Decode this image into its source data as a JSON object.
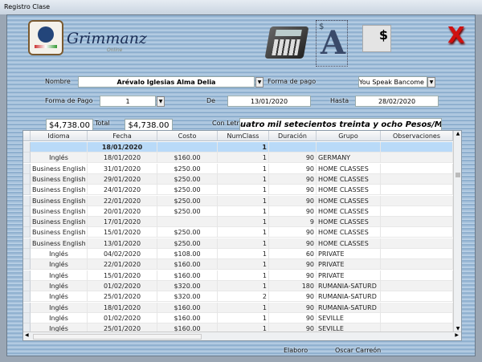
{
  "window": {
    "title": "Registro Clase"
  },
  "logo": {
    "text": "Grimmanz",
    "subtext": "Online"
  },
  "toolbar": {
    "calculator": "calculator-icon",
    "letter": "A",
    "letter_prefix": "$",
    "invoice": "$",
    "close": "X"
  },
  "form": {
    "nombre_label": "Nombre",
    "nombre_value": "Arévalo Iglesias Alma Delia",
    "forma_pago_label": "Forma de pago",
    "forma_pago_value": "You Speak Bancome",
    "forma_pago2_label": "Forma de Pago",
    "forma_pago2_value": "1",
    "de_label": "De",
    "de_value": "13/01/2020",
    "hasta_label": "Hasta",
    "hasta_value": "28/02/2020",
    "subtotal_value": "$4,738.00",
    "total_label": "Total",
    "total_value": "$4,738.00",
    "con_letra_label": "Con Letra",
    "con_letra_value": "uatro mil setecientos treinta y ocho Pesos/MN"
  },
  "grid": {
    "columns": [
      "Idioma",
      "Fecha",
      "Costo",
      "NumClass",
      "Duración",
      "Grupo",
      "Observaciones"
    ],
    "rows": [
      [
        "",
        "18/01/2020",
        "",
        "1",
        "",
        "",
        ""
      ],
      [
        "Inglés",
        "18/01/2020",
        "$160.00",
        "1",
        "90",
        "GERMANY",
        ""
      ],
      [
        "Business English",
        "31/01/2020",
        "$250.00",
        "1",
        "90",
        "HOME CLASSES",
        ""
      ],
      [
        "Business English",
        "29/01/2020",
        "$250.00",
        "1",
        "90",
        "HOME CLASSES",
        ""
      ],
      [
        "Business English",
        "24/01/2020",
        "$250.00",
        "1",
        "90",
        "HOME CLASSES",
        ""
      ],
      [
        "Business English",
        "22/01/2020",
        "$250.00",
        "1",
        "90",
        "HOME CLASSES",
        ""
      ],
      [
        "Business English",
        "20/01/2020",
        "$250.00",
        "1",
        "90",
        "HOME CLASSES",
        ""
      ],
      [
        "Business English",
        "17/01/2020",
        "",
        "1",
        "9",
        "HOME CLASSES",
        ""
      ],
      [
        "Business English",
        "15/01/2020",
        "$250.00",
        "1",
        "90",
        "HOME CLASSES",
        ""
      ],
      [
        "Business English",
        "13/01/2020",
        "$250.00",
        "1",
        "90",
        "HOME CLASSES",
        ""
      ],
      [
        "Inglés",
        "04/02/2020",
        "$108.00",
        "1",
        "60",
        "PRIVATE",
        ""
      ],
      [
        "Inglés",
        "22/01/2020",
        "$160.00",
        "1",
        "90",
        "PRIVATE",
        ""
      ],
      [
        "Inglés",
        "15/01/2020",
        "$160.00",
        "1",
        "90",
        "PRIVATE",
        ""
      ],
      [
        "Inglés",
        "01/02/2020",
        "$320.00",
        "1",
        "180",
        "RUMANIA-SATURD",
        ""
      ],
      [
        "Inglés",
        "25/01/2020",
        "$320.00",
        "2",
        "90",
        "RUMANIA-SATURD",
        ""
      ],
      [
        "Inglés",
        "18/01/2020",
        "$160.00",
        "1",
        "90",
        "RUMANIA-SATURD",
        ""
      ],
      [
        "Inglés",
        "01/02/2020",
        "$160.00",
        "1",
        "90",
        "SEVILLE",
        ""
      ],
      [
        "Inglés",
        "25/01/2020",
        "$160.00",
        "1",
        "90",
        "SEVILLE",
        ""
      ]
    ]
  },
  "footer": {
    "elaboro_label": "Elaboro",
    "elaboro_value": "Oscar Carreón"
  }
}
